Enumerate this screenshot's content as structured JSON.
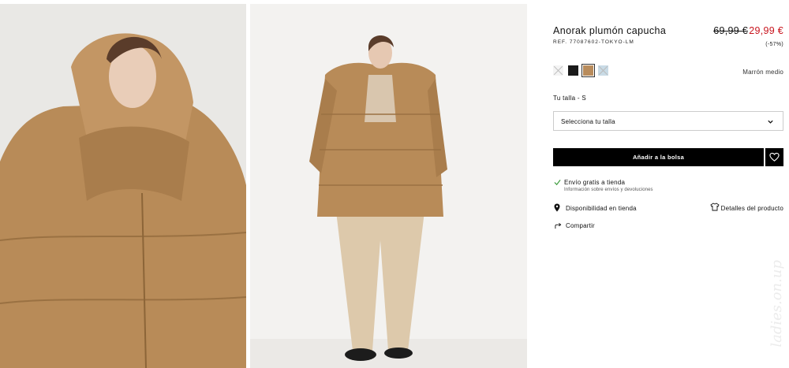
{
  "product": {
    "title": "Anorak plumón capucha",
    "ref": "REF. 77087602-TOKYO-LM",
    "price_old": "69,99 €",
    "price_new": "29,99 €",
    "discount": "(-57%)",
    "color_name": "Marrón medio"
  },
  "swatches": [
    {
      "name": "white",
      "color": "#f4f4f4",
      "unavailable": true,
      "selected": false
    },
    {
      "name": "black",
      "color": "#1a1a1a",
      "unavailable": false,
      "selected": false
    },
    {
      "name": "medium-brown",
      "color": "#b98c5c",
      "unavailable": false,
      "selected": true
    },
    {
      "name": "light-blue",
      "color": "#c9dbe6",
      "unavailable": true,
      "selected": false
    }
  ],
  "size": {
    "label": "Tu talla - S",
    "select_placeholder": "Selecciona tu talla"
  },
  "actions": {
    "add_to_bag": "Añadir a la bolsa",
    "store_availability": "Disponibilidad en tienda",
    "product_details": "Detalles del producto",
    "share": "Compartir"
  },
  "shipping": {
    "title": "Envío gratis a tienda",
    "subtitle": "Información sobre envíos y devoluciones"
  },
  "watermark": "ladies.on.up",
  "colors": {
    "accent_sale": "#c8141d",
    "button_bg": "#000000",
    "check_green": "#3c9b3c"
  }
}
